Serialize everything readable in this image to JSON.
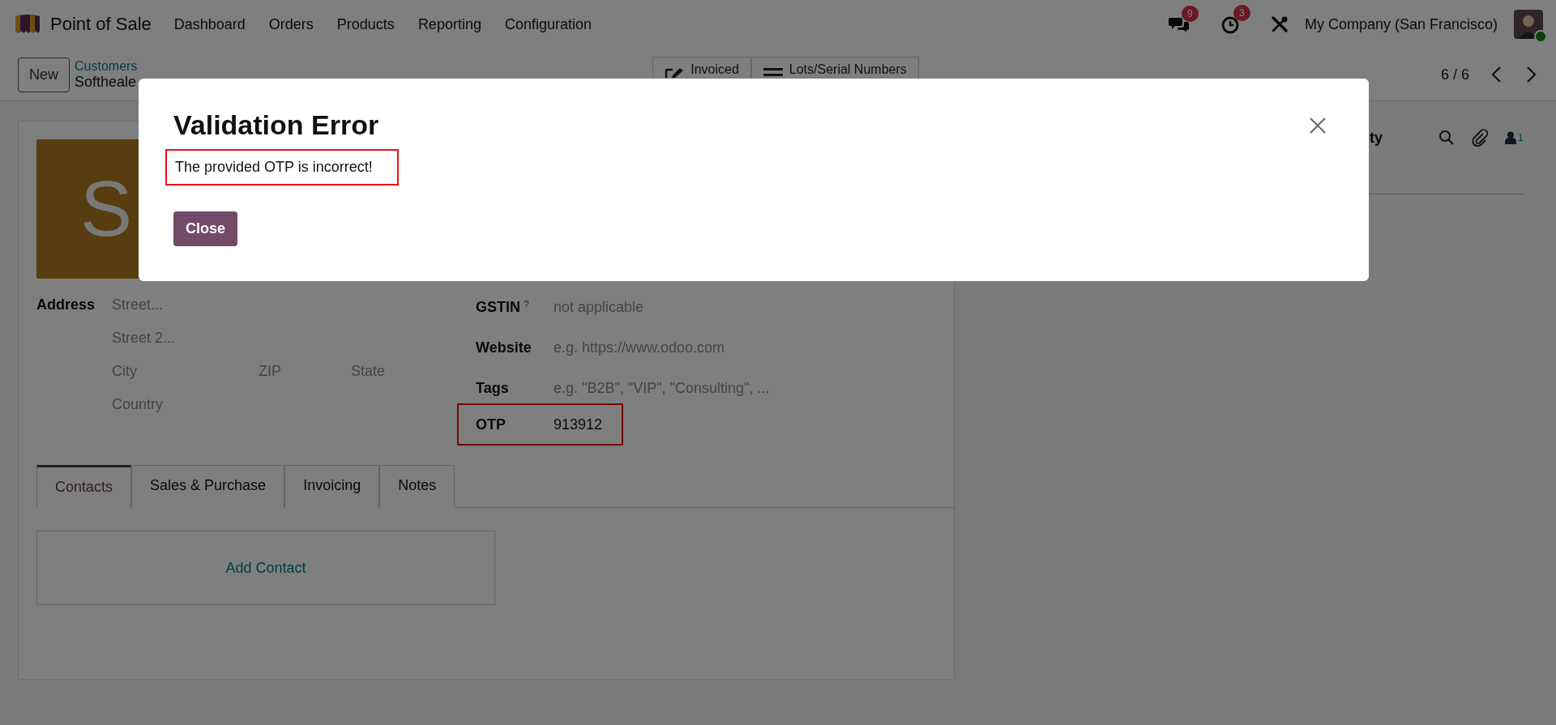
{
  "navbar": {
    "app_name": "Point of Sale",
    "menu": [
      "Dashboard",
      "Orders",
      "Products",
      "Reporting",
      "Configuration"
    ],
    "messages_count": "9",
    "activities_count": "3",
    "company": "My Company (San Francisco)"
  },
  "control_panel": {
    "new_button": "New",
    "breadcrumb": "Customers",
    "record_name": "Softheale",
    "smart_buttons": [
      {
        "label": "Invoiced",
        "kind": "edit"
      },
      {
        "label": "Lots/Serial Numbers",
        "kind": "list"
      }
    ],
    "pager": "6 / 6"
  },
  "form": {
    "avatar_letter": "S",
    "address": {
      "label": "Address",
      "street": "Street...",
      "street2": "Street 2...",
      "city": "City",
      "zip": "ZIP",
      "state": "State",
      "country": "Country"
    },
    "fields": [
      {
        "label": "GSTIN",
        "help": "?",
        "placeholder": "not applicable",
        "highlighted": false
      },
      {
        "label": "Website",
        "placeholder": "e.g. https://www.odoo.com",
        "highlighted": false
      },
      {
        "label": "Tags",
        "placeholder": "e.g. \"B2B\", \"VIP\", \"Consulting\", ...",
        "highlighted": false
      },
      {
        "label": "OTP",
        "value": "913912",
        "highlighted": true
      }
    ],
    "tabs": [
      {
        "label": "Contacts",
        "selected": true
      },
      {
        "label": "Sales & Purchase",
        "selected": false
      },
      {
        "label": "Invoicing",
        "selected": false
      },
      {
        "label": "Notes",
        "selected": false
      }
    ],
    "add_contact": "Add Contact"
  },
  "chatter": {
    "button_text": "ty",
    "follower_count": "1"
  },
  "dialog": {
    "title": "Validation Error",
    "message": "The provided OTP is incorrect!",
    "message_highlighted": true,
    "button": "Close"
  }
}
